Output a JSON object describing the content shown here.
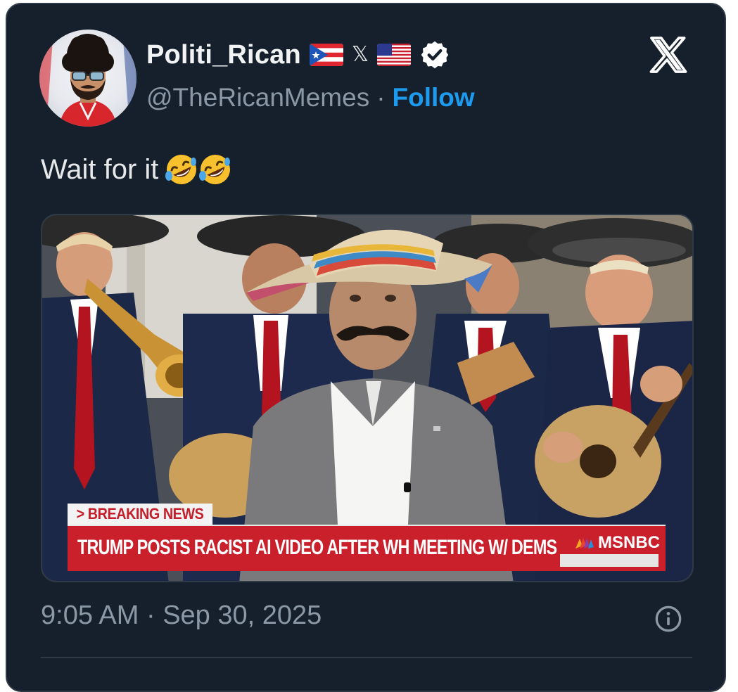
{
  "author": {
    "display_name": "Politi_Rican",
    "badge_x": "𝕏",
    "handle": "@TheRicanMemes",
    "separator": "·",
    "follow_label": "Follow"
  },
  "tweet": {
    "text": "Wait for it",
    "emoji_names": [
      "rolling-on-floor-laughing",
      "rolling-on-floor-laughing"
    ]
  },
  "media": {
    "breaking_label": "> BREAKING NEWS",
    "headline": "TRUMP POSTS RACIST AI VIDEO AFTER WH MEETING W/ DEMS",
    "network": "MSNBC"
  },
  "footer": {
    "timestamp": "9:05 AM · Sep 30, 2025"
  },
  "icons": [
    "puerto-rico-flag-icon",
    "x-badge-icon",
    "us-flag-icon",
    "verified-badge-icon",
    "x-logo-icon",
    "info-icon"
  ],
  "colors": {
    "background": "#16202c",
    "accent": "#1d9bf0",
    "muted": "#8b98a5",
    "news_red": "#c9202c"
  }
}
